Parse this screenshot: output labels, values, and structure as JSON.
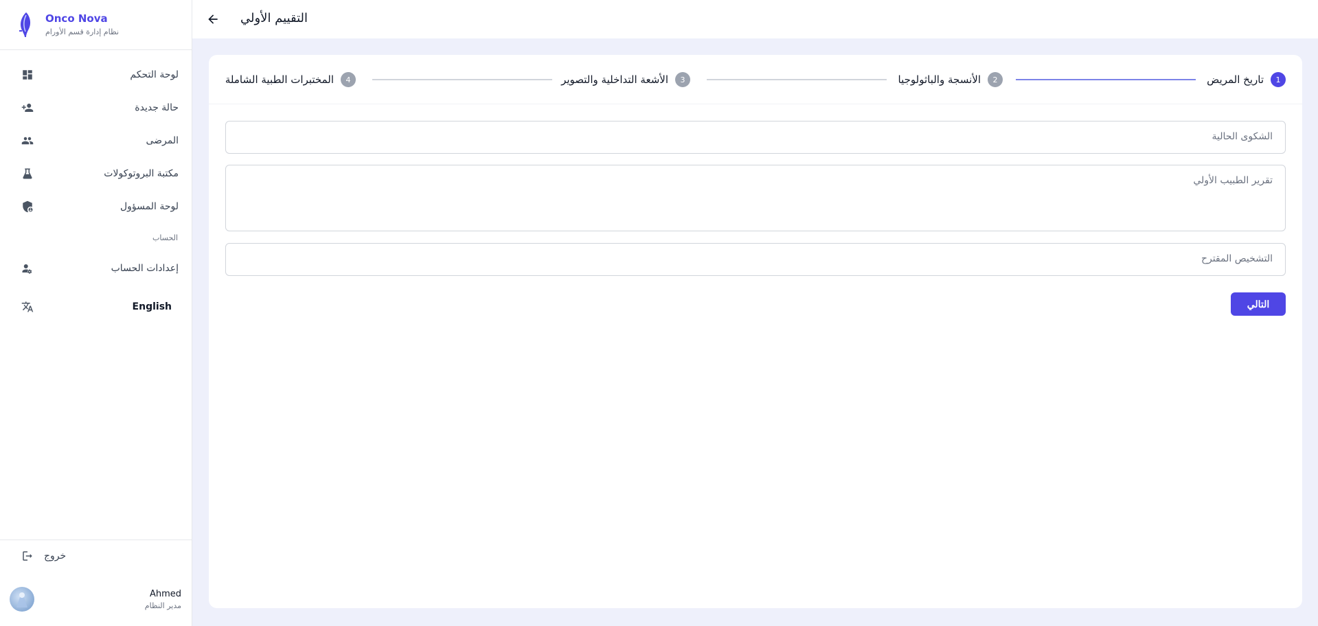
{
  "brand": {
    "name": "Onco Nova",
    "subtitle": "نظام إدارة قسم الأورام"
  },
  "sidebar": {
    "items": [
      {
        "label": "لوحة التحكم",
        "icon": "dashboard-icon"
      },
      {
        "label": "حالة جديدة",
        "icon": "person-add-icon"
      },
      {
        "label": "المرضى",
        "icon": "people-icon"
      },
      {
        "label": "مكتبة البروتوكولات",
        "icon": "flask-icon"
      },
      {
        "label": "لوحة المسؤول",
        "icon": "admin-shield-icon"
      }
    ],
    "section_account": "الحساب",
    "account_settings": "إعدادات الحساب",
    "language": "English",
    "logout": "خروج",
    "user": {
      "name": "Ahmed",
      "role": "مدير النظام"
    }
  },
  "topbar": {
    "title": "التقييم الأولي"
  },
  "stepper": {
    "steps": [
      {
        "num": "1",
        "label": "تاريخ المريض",
        "active": true
      },
      {
        "num": "2",
        "label": "الأنسجة والباثولوجيا",
        "active": false
      },
      {
        "num": "3",
        "label": "الأشعة التداخلية والتصوير",
        "active": false
      },
      {
        "num": "4",
        "label": "المختبرات الطبية الشاملة",
        "active": false
      }
    ]
  },
  "form": {
    "current_complaint": "الشكوى الحالية",
    "initial_report": "تقرير الطبيب الأولي",
    "proposed_diagnosis": "التشخيص المقترح",
    "next_label": "التالي"
  },
  "colors": {
    "accent": "#4f46e5",
    "background": "#eef0fb"
  }
}
